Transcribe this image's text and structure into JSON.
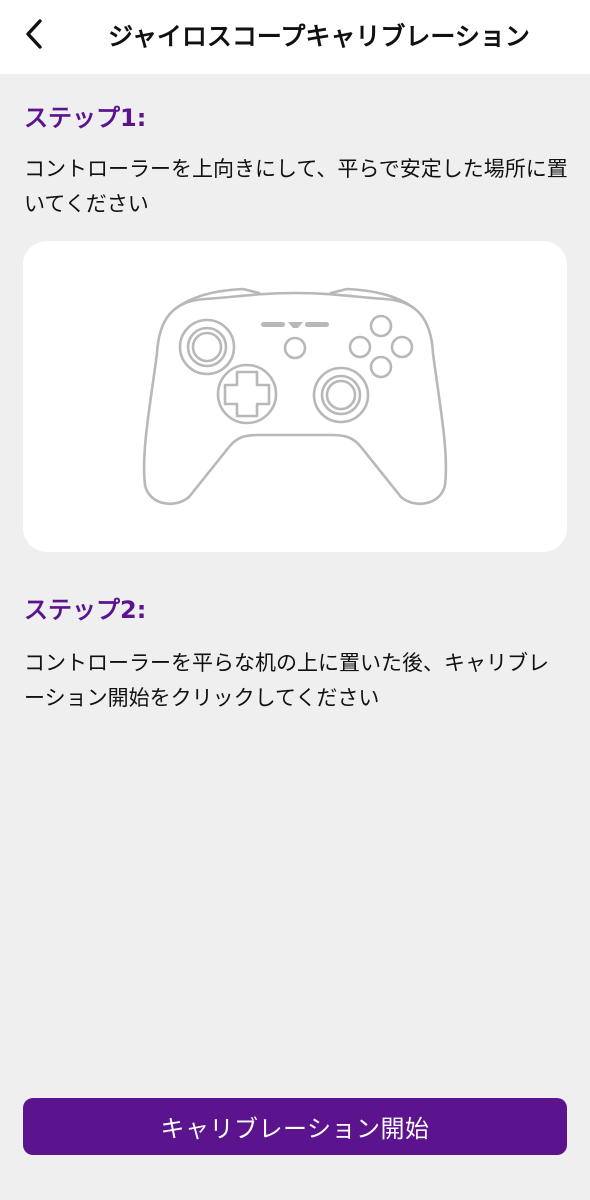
{
  "header": {
    "title": "ジャイロスコープキャリブレーション",
    "back_icon": "chevron-left-icon"
  },
  "step1": {
    "title": "ステップ1:",
    "text": "コントローラーを上向きにして、平らで安定した場所に置いてください"
  },
  "illustration": {
    "icon": "gamepad-icon"
  },
  "step2": {
    "title": "ステップ2:",
    "text": "コントローラーを平らな机の上に置いた後、キャリブレーション開始をクリックしてください"
  },
  "action": {
    "start_label": "キャリブレーション開始"
  },
  "colors": {
    "accent": "#5b148e",
    "background": "#efeff0",
    "card": "#ffffff"
  }
}
